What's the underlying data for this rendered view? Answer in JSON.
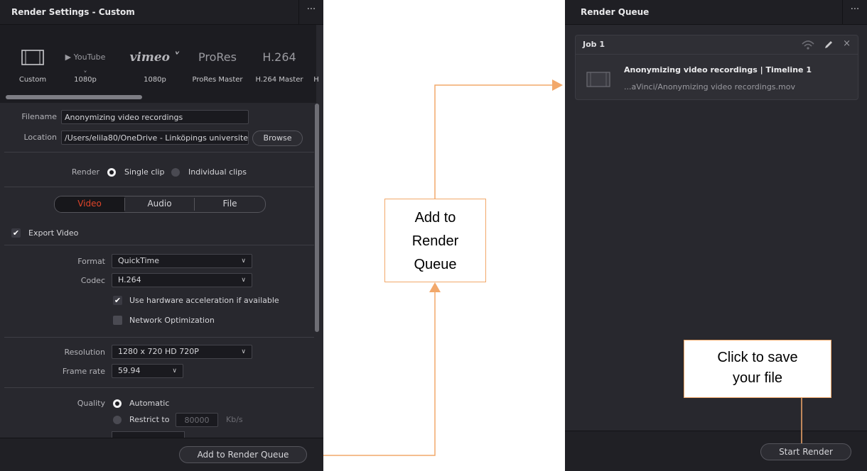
{
  "left": {
    "title": "Render Settings - Custom",
    "menu_dots": "···",
    "presets": [
      {
        "logo": "▢",
        "label": "Custom"
      },
      {
        "logo": "▶ YouTube ˅",
        "label": "1080p"
      },
      {
        "logo": "vimeo ˅",
        "label": "1080p"
      },
      {
        "logo": "ProRes",
        "label": "ProRes Master"
      },
      {
        "logo": "H.264",
        "label": "H.264 Master"
      },
      {
        "logo": "",
        "label": "H"
      }
    ],
    "filename_label": "Filename",
    "filename_value": "Anonymizing video recordings",
    "location_label": "Location",
    "location_value": "/Users/elila80/OneDrive - Linköpings universite",
    "browse_label": "Browse",
    "render_label": "Render",
    "single_clip": "Single clip",
    "individual_clips": "Individual clips",
    "tabs": {
      "video": "Video",
      "audio": "Audio",
      "file": "File"
    },
    "export_video": "Export Video",
    "format_label": "Format",
    "format_value": "QuickTime",
    "codec_label": "Codec",
    "codec_value": "H.264",
    "hw_accel": "Use hardware acceleration if available",
    "network_opt": "Network Optimization",
    "resolution_label": "Resolution",
    "resolution_value": "1280 x 720 HD 720P",
    "framerate_label": "Frame rate",
    "framerate_value": "59.94",
    "quality_label": "Quality",
    "quality_automatic": "Automatic",
    "quality_restrict": "Restrict to",
    "quality_kbps_value": "80000",
    "quality_unit": "Kb/s",
    "add_to_queue": "Add to Render Queue"
  },
  "right": {
    "title": "Render Queue",
    "menu_dots": "···",
    "job_label": "Job 1",
    "job_title": "Anonymizing video recordings | Timeline 1",
    "job_path": "...aVinci/Anonymizing video recordings.mov",
    "start_render": "Start Render"
  },
  "annotations": {
    "add_to_queue": [
      "Add to",
      "Render",
      "Queue"
    ],
    "click_to_save": [
      "Click to save",
      "your file"
    ]
  },
  "colors": {
    "panel_bg": "#28282e",
    "active_tab": "#e0452a",
    "annotation_border": "#f2a86a"
  }
}
